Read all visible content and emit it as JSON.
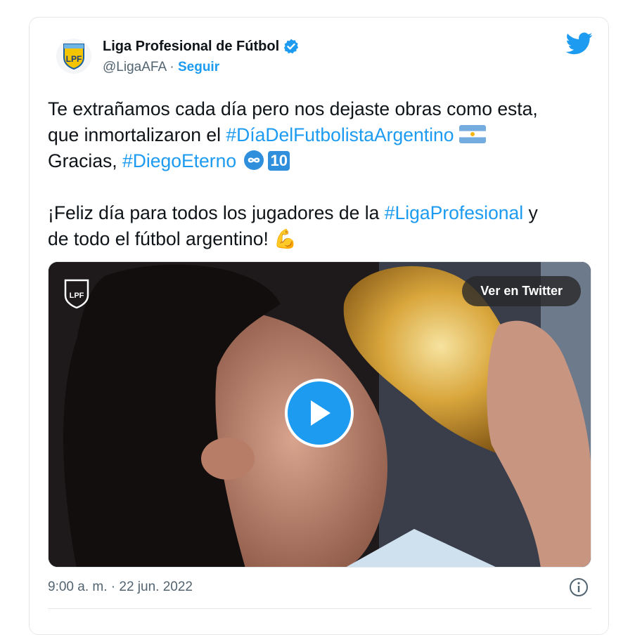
{
  "account": {
    "name": "Liga Profesional de Fútbol",
    "handle": "@LigaAFA",
    "separator": " · ",
    "follow_label": "Seguir",
    "logo_text": "LPF",
    "verified": true
  },
  "tweet": {
    "line1": "Te extrañamos cada día pero nos dejaste obras como esta,",
    "line2_pre": "que inmortalizaron el ",
    "hashtag1": "#DíaDelFutbolistaArgentino",
    "line3_pre": "Gracias, ",
    "hashtag2": "#DiegoEterno",
    "keycap_10": "10",
    "para2_pre": "¡Feliz día para todos los jugadores de la ",
    "hashtag3": "#LigaProfesional",
    "para2_mid": " y",
    "para2_line2": "de todo el fútbol argentino! ",
    "emoji_muscle": "💪"
  },
  "media": {
    "watch_label": "Ver en Twitter",
    "watermark_text": "LPF"
  },
  "meta": {
    "timestamp": "9:00 a. m. · 22 jun. 2022"
  },
  "colors": {
    "accent": "#1d9bf0",
    "secondary_text": "#536471",
    "text": "#0f1419",
    "border": "#e3e7ea"
  }
}
